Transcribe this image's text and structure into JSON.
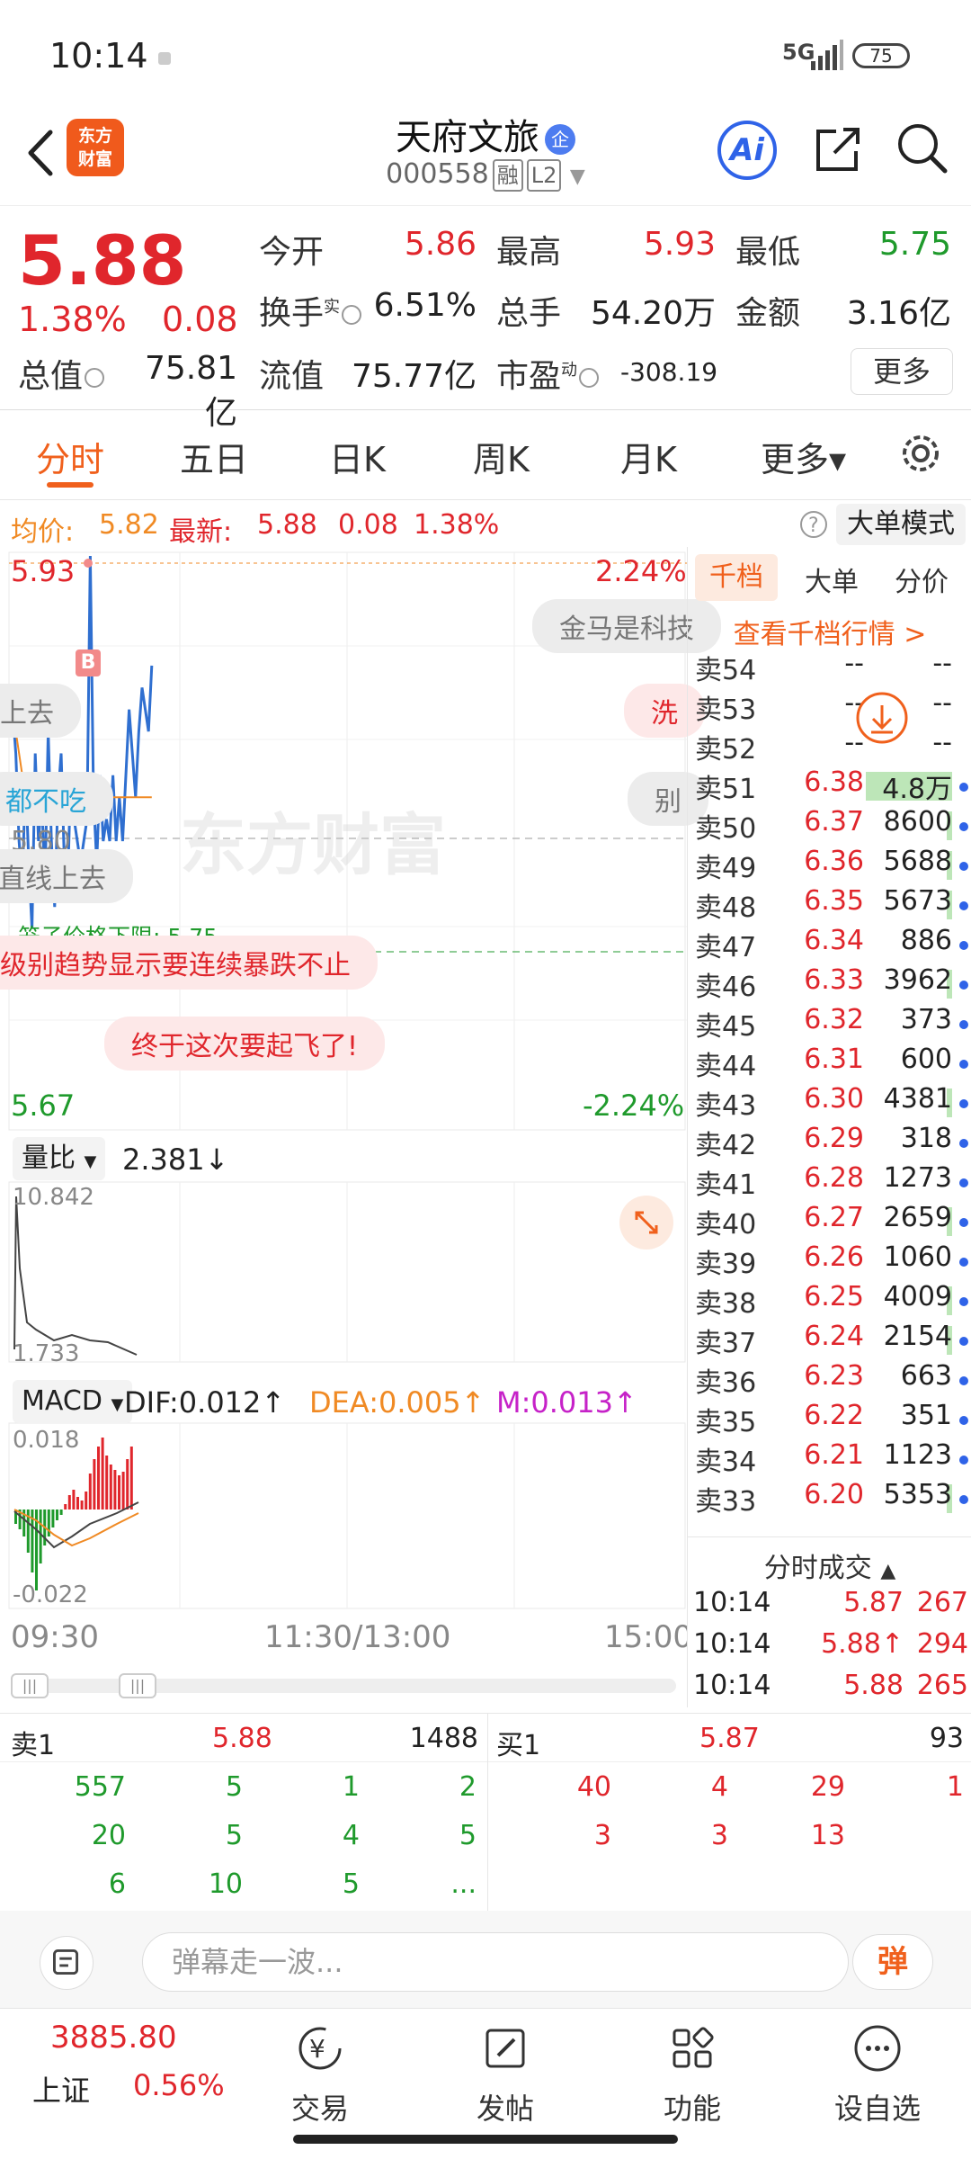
{
  "status": {
    "time": "10:14",
    "network": "5G",
    "battery": "75"
  },
  "header": {
    "logo_line1": "东方",
    "logo_line2": "财富",
    "title": "天府文旅",
    "badge": "企",
    "code": "000558",
    "tag1": "融",
    "tag2": "L2",
    "ai": "Ai"
  },
  "quote": {
    "price": "5.88",
    "pct": "1.38%",
    "change": "0.08",
    "open_label": "今开",
    "open": "5.86",
    "high_label": "最高",
    "high": "5.93",
    "low_label": "最低",
    "low": "5.75",
    "turnover_label": "换手",
    "turnover_sup": "实",
    "turnover": "6.51%",
    "volume_label": "总手",
    "volume": "54.20万",
    "amount_label": "金额",
    "amount": "3.16亿",
    "mktcap_label": "总值",
    "mktcap": "75.81亿",
    "float_label": "流值",
    "float": "75.77亿",
    "pe_label": "市盈",
    "pe_sup": "动",
    "pe": "-308.19",
    "more": "更多"
  },
  "tabs": {
    "t1": "分时",
    "t2": "五日",
    "t3": "日K",
    "t4": "周K",
    "t5": "月K",
    "t6": "更多▾"
  },
  "info": {
    "avg_label": "均价:",
    "avg": "5.82",
    "latest_label": "最新:",
    "latest": "5.88",
    "chg": "0.08",
    "pct": "1.38%",
    "dadan": "大单模式"
  },
  "chart": {
    "price_high": "5.93",
    "price_low": "5.67",
    "pct_high": "2.24%",
    "pct_low": "-2.24%",
    "midline": "5.80",
    "limit_label": "笼子价格下限:",
    "limit": "5.75",
    "watermark": "东方财富",
    "marker": "B",
    "vol_label": "量比",
    "vol_value": "2.381↓",
    "vol_max": "10.842",
    "vol_min": "1.733",
    "macd_label": "MACD",
    "dif": "DIF:0.012↑",
    "dea": "DEA:0.005↑",
    "m": "M:0.013↑",
    "macd_max": "0.018",
    "macd_min": "-0.022",
    "time_start": "09:30",
    "time_mid": "11:30/13:00",
    "time_end": "15:00",
    "bubbles": [
      "金马是科技",
      "上去",
      "洗",
      "都不吃",
      "别",
      "直线上去",
      "级别趋势显示要连续暴跌不止",
      "终于这次要起飞了!"
    ]
  },
  "chart_data": {
    "type": "line",
    "title": "",
    "x": [
      0,
      1,
      2,
      3,
      4,
      5,
      6,
      7,
      8,
      9,
      10,
      11,
      12,
      13,
      14,
      15,
      16,
      17,
      18,
      19,
      20,
      21,
      22,
      23,
      24,
      25,
      26,
      27,
      28,
      29,
      30,
      31,
      32,
      33,
      34,
      35,
      36,
      37,
      38,
      39,
      40,
      41,
      42,
      43
    ],
    "series": [
      {
        "name": "",
        "values": [
          5.86,
          5.84,
          5.8,
          5.78,
          5.83,
          5.79,
          5.76,
          5.84,
          5.8,
          5.82,
          5.78,
          5.85,
          5.8,
          5.77,
          5.82,
          5.84,
          5.79,
          5.78,
          5.83,
          5.81,
          5.8,
          5.79,
          5.8,
          5.81,
          5.93,
          5.82,
          5.79,
          5.83,
          5.8,
          5.81,
          5.8,
          5.83,
          5.8,
          5.82,
          5.8,
          5.83,
          5.86,
          5.84,
          5.82,
          5.85,
          5.87,
          5.86,
          5.85,
          5.88
        ]
      },
      {
        "name": "",
        "values": [
          5.86,
          5.85,
          5.84,
          5.83,
          5.83,
          5.82,
          5.82,
          5.82,
          5.82,
          5.82,
          5.82,
          5.82,
          5.82,
          5.82,
          5.82,
          5.82,
          5.82,
          5.82,
          5.82,
          5.82,
          5.82,
          5.82,
          5.82,
          5.82,
          5.82,
          5.82,
          5.82,
          5.82,
          5.82,
          5.82,
          5.82,
          5.82,
          5.82,
          5.82,
          5.82,
          5.82,
          5.82,
          5.82,
          5.82,
          5.82,
          5.82,
          5.82,
          5.82,
          5.82
        ]
      }
    ],
    "ylim": [
      5.67,
      5.93
    ],
    "xlabel": "",
    "ylabel": ""
  },
  "book": {
    "tab1": "千档",
    "tab2": "大单",
    "tab3": "分价",
    "link": "查看千档行情 >",
    "rows": [
      {
        "label": "卖54",
        "price": "--",
        "vol": "--",
        "bar": 0,
        "dot": false
      },
      {
        "label": "卖53",
        "price": "--",
        "vol": "--",
        "bar": 0,
        "dot": false
      },
      {
        "label": "卖52",
        "price": "--",
        "vol": "--",
        "bar": 0,
        "dot": false
      },
      {
        "label": "卖51",
        "price": "6.38",
        "vol": "4.8万",
        "bar": 1.0,
        "dot": true
      },
      {
        "label": "卖50",
        "price": "6.37",
        "vol": "8600",
        "bar": 0.06,
        "dot": true
      },
      {
        "label": "卖49",
        "price": "6.36",
        "vol": "5688",
        "bar": 0.04,
        "dot": true
      },
      {
        "label": "卖48",
        "price": "6.35",
        "vol": "5673",
        "bar": 0.04,
        "dot": true
      },
      {
        "label": "卖47",
        "price": "6.34",
        "vol": "886",
        "bar": 0,
        "dot": true
      },
      {
        "label": "卖46",
        "price": "6.33",
        "vol": "3962",
        "bar": 0.03,
        "dot": true
      },
      {
        "label": "卖45",
        "price": "6.32",
        "vol": "373",
        "bar": 0,
        "dot": true
      },
      {
        "label": "卖44",
        "price": "6.31",
        "vol": "600",
        "bar": 0,
        "dot": true
      },
      {
        "label": "卖43",
        "price": "6.30",
        "vol": "4381",
        "bar": 0.03,
        "dot": true
      },
      {
        "label": "卖42",
        "price": "6.29",
        "vol": "318",
        "bar": 0,
        "dot": true
      },
      {
        "label": "卖41",
        "price": "6.28",
        "vol": "1273",
        "bar": 0,
        "dot": true
      },
      {
        "label": "卖40",
        "price": "6.27",
        "vol": "2659",
        "bar": 0.02,
        "dot": true
      },
      {
        "label": "卖39",
        "price": "6.26",
        "vol": "1060",
        "bar": 0,
        "dot": true
      },
      {
        "label": "卖38",
        "price": "6.25",
        "vol": "4009",
        "bar": 0.03,
        "dot": true
      },
      {
        "label": "卖37",
        "price": "6.24",
        "vol": "2154",
        "bar": 0.02,
        "dot": true
      },
      {
        "label": "卖36",
        "price": "6.23",
        "vol": "663",
        "bar": 0,
        "dot": true
      },
      {
        "label": "卖35",
        "price": "6.22",
        "vol": "351",
        "bar": 0,
        "dot": true
      },
      {
        "label": "卖34",
        "price": "6.21",
        "vol": "1123",
        "bar": 0,
        "dot": true
      },
      {
        "label": "卖33",
        "price": "6.20",
        "vol": "5353",
        "bar": 0.04,
        "dot": true
      }
    ],
    "trades_title": "分时成交",
    "trades": [
      {
        "time": "10:14",
        "price": "5.87",
        "vol": "267"
      },
      {
        "time": "10:14",
        "price": "5.88↑",
        "vol": "294"
      },
      {
        "time": "10:14",
        "price": "5.88",
        "vol": "265"
      }
    ]
  },
  "strip": {
    "sell_label": "卖1",
    "sell_price": "5.88",
    "sell_vol": "1488",
    "buy_label": "买1",
    "buy_price": "5.87",
    "buy_vol": "93",
    "sell_rows": [
      [
        "557",
        "5",
        "1",
        "2"
      ],
      [
        "20",
        "5",
        "4",
        "5"
      ],
      [
        "6",
        "10",
        "5",
        "..."
      ]
    ],
    "buy_rows": [
      [
        "40",
        "4",
        "29",
        "1"
      ],
      [
        "3",
        "3",
        "13",
        ""
      ]
    ]
  },
  "comment": {
    "placeholder": "弹幕走一波...",
    "send": "弹"
  },
  "nav": {
    "index_value": "3885.80",
    "index_name": "上证",
    "index_pct": "0.56%",
    "trade": "交易",
    "post": "发帖",
    "func": "功能",
    "watch": "设自选"
  }
}
